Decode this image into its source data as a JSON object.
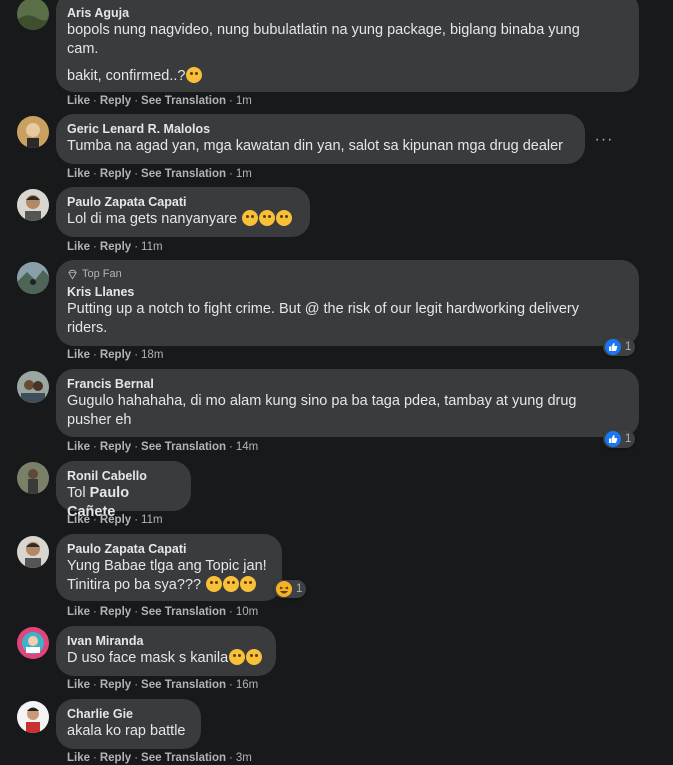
{
  "comments": [
    {
      "author": "Aris Aguja",
      "lines": [
        "bopols nung nagvideo, nung bubulatlatin na yung package, biglang binaba yung\ncam.",
        "bakit, confirmed..?"
      ],
      "actions": {
        "like": "Like",
        "reply": "Reply",
        "translation": "See Translation",
        "time": "1m"
      }
    },
    {
      "author": "Geric Lenard R. Malolos",
      "text": "Tumba na agad yan, mga kawatan din yan, salot sa kipunan mga drug dealer",
      "actions": {
        "like": "Like",
        "reply": "Reply",
        "translation": "See Translation",
        "time": "1m"
      },
      "more": "···"
    },
    {
      "author": "Paulo Zapata Capati",
      "text": "Lol di ma gets nanyanyare",
      "actions": {
        "like": "Like",
        "reply": "Reply",
        "time": "11m"
      }
    },
    {
      "badge": "Top Fan",
      "author": "Kris Llanes",
      "text": "Putting up a notch to fight crime. But @ the risk of our legit hardworking delivery\nriders.",
      "actions": {
        "like": "Like",
        "reply": "Reply",
        "time": "18m"
      },
      "reaction_count": "1"
    },
    {
      "author": "Francis Bernal",
      "text": "Gugulo hahahaha, di mo alam kung sino pa ba taga pdea, tambay at yung drug\npusher eh",
      "actions": {
        "like": "Like",
        "reply": "Reply",
        "translation": "See Translation",
        "time": "14m"
      },
      "reaction_count": "1"
    },
    {
      "author": "Ronil Cabello",
      "prefix": "Tol ",
      "mention": "Paulo Cañete",
      "actions": {
        "like": "Like",
        "reply": "Reply",
        "time": "11m"
      }
    },
    {
      "author": "Paulo Zapata Capati",
      "text": "Yung Babae tlga ang Topic jan!\nTinitira po ba sya???",
      "actions": {
        "like": "Like",
        "reply": "Reply",
        "translation": "See Translation",
        "time": "10m"
      },
      "reaction_count": "1"
    },
    {
      "author": "Ivan Miranda",
      "text": "D uso face mask s kanila",
      "actions": {
        "like": "Like",
        "reply": "Reply",
        "translation": "See Translation",
        "time": "16m"
      }
    },
    {
      "author": "Charlie Gie",
      "text": "akala ko rap battle",
      "actions": {
        "like": "Like",
        "reply": "Reply",
        "translation": "See Translation",
        "time": "3m"
      }
    }
  ],
  "colors": {
    "background": "#18191a",
    "bubble": "#3a3b3c",
    "like_blue": "#1877f2",
    "muted": "#b0b3b8",
    "text": "#e4e6eb"
  },
  "icons": [
    "like-icon",
    "haha-icon",
    "more-icon",
    "top-fan-diamond-icon"
  ]
}
